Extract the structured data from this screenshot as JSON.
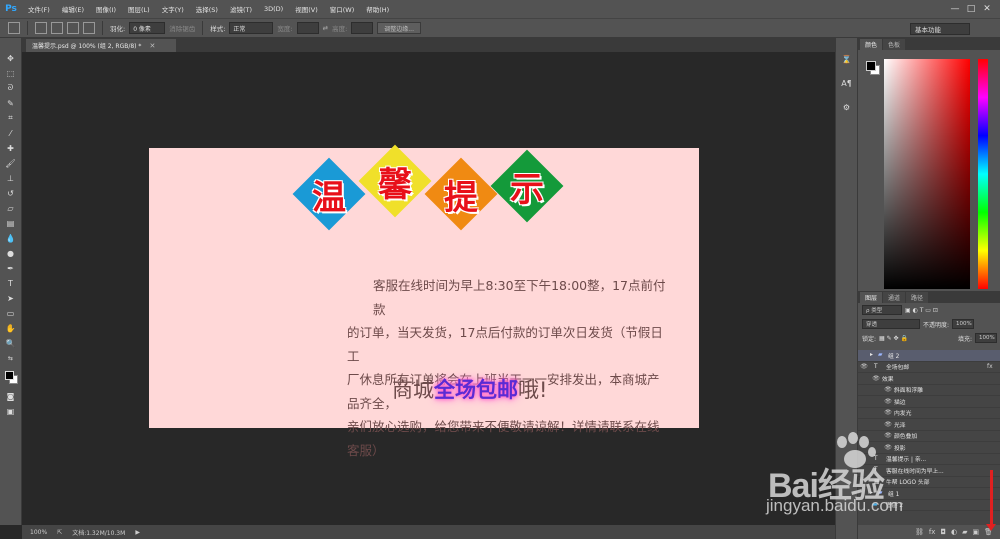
{
  "app": {
    "logo": "Ps"
  },
  "menu": [
    "文件(F)",
    "编辑(E)",
    "图像(I)",
    "图层(L)",
    "文字(Y)",
    "选择(S)",
    "滤镜(T)",
    "3D(D)",
    "视图(V)",
    "窗口(W)",
    "帮助(H)"
  ],
  "window_controls": [
    "—",
    "□",
    "✕"
  ],
  "options": {
    "feather_label": "羽化:",
    "feather_value": "0 像素",
    "antialias_label": "消除锯齿",
    "style_label": "样式:",
    "style_value": "正常",
    "width_label": "宽度:",
    "height_label": "高度:",
    "refine_edge": "调整边缘...",
    "workspace": "基本功能"
  },
  "document": {
    "tab_title": "温馨提示.psd @ 100% (组 2, RGB/8) *",
    "close": "✕",
    "title_chars": [
      {
        "char": "温",
        "color": "#1a9ad6"
      },
      {
        "char": "馨",
        "color": "#f0e02a"
      },
      {
        "char": "提",
        "color": "#f08a12"
      },
      {
        "char": "示",
        "color": "#149a3a"
      }
    ],
    "notice_lines": [
      "客服在线时间为早上8:30至下午18:00整，17点前付款",
      "的订单，当天发货，17点后付款的订单次日发货（节假日工",
      "厂休息所有订单将会在上班当天一一安排发出，本商城产品齐全，",
      "亲们放心选购，给您带来不便敬请谅解！详情请联系在线客服）"
    ],
    "slogan_pre": "商城",
    "slogan_highlight": "全场包邮",
    "slogan_post": "哦!"
  },
  "status": {
    "zoom": "100%",
    "doc_info": "文档:1.32M/10.3M"
  },
  "color_panel": {
    "tabs": [
      "颜色",
      "色板"
    ]
  },
  "layers_panel": {
    "tabs": [
      "图层",
      "通道",
      "路径"
    ],
    "kind_filter": "ρ 类型",
    "blend_mode": "穿透",
    "opacity_label": "不透明度:",
    "opacity_value": "100%",
    "lock_label": "锁定:",
    "fill_label": "填充:",
    "fill_value": "100%",
    "layers": [
      {
        "name": "组 2",
        "type": "group",
        "eye": "",
        "fx": ""
      },
      {
        "name": "全场包邮",
        "type": "text",
        "eye": "👁",
        "fx": "fx"
      },
      {
        "name": "效果",
        "type": "effects",
        "eye": "👁",
        "fx": ""
      },
      {
        "name": "斜面和浮雕",
        "type": "effect",
        "eye": "👁",
        "fx": ""
      },
      {
        "name": "描边",
        "type": "effect",
        "eye": "👁",
        "fx": ""
      },
      {
        "name": "内发光",
        "type": "effect",
        "eye": "👁",
        "fx": ""
      },
      {
        "name": "光泽",
        "type": "effect",
        "eye": "👁",
        "fx": ""
      },
      {
        "name": "颜色叠加",
        "type": "effect",
        "eye": "👁",
        "fx": ""
      },
      {
        "name": "投影",
        "type": "effect",
        "eye": "👁",
        "fx": ""
      },
      {
        "name": "温馨提示 | 亲...",
        "type": "text",
        "eye": "",
        "fx": ""
      },
      {
        "name": "客服在线时间为早上...",
        "type": "text",
        "eye": "",
        "fx": ""
      },
      {
        "name": "牛帮 LOGO 头部",
        "type": "layer",
        "eye": "",
        "fx": ""
      },
      {
        "name": "组 1",
        "type": "group",
        "eye": "",
        "fx": ""
      },
      {
        "name": "图层 2",
        "type": "layer",
        "eye": "",
        "fx": ""
      }
    ]
  },
  "watermark": {
    "brand": "Bai经验",
    "url": "jingyan.baidu.com"
  }
}
